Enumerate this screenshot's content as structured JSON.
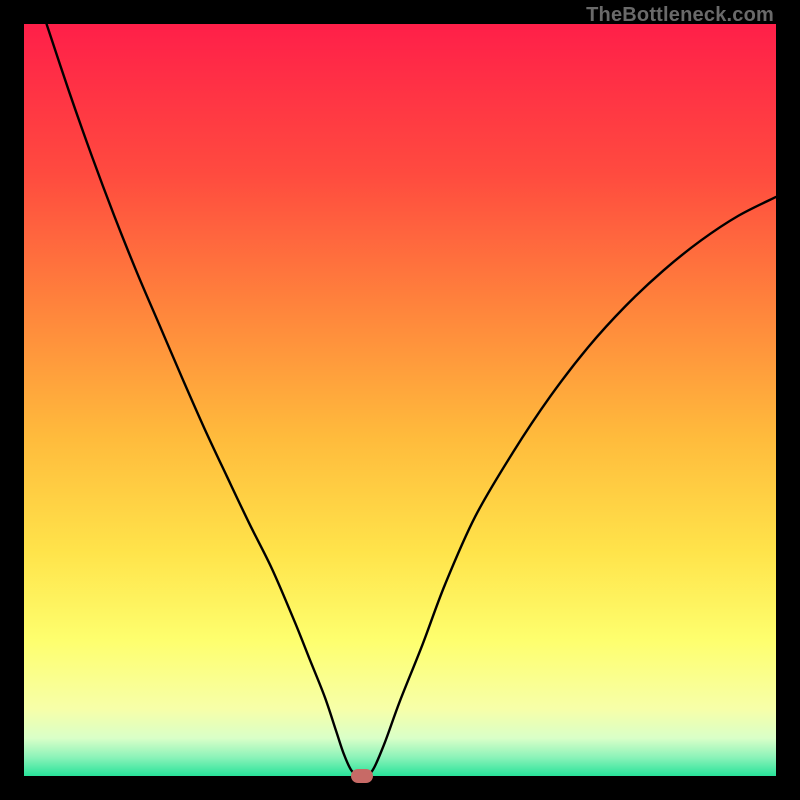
{
  "watermark": "TheBottleneck.com",
  "colors": {
    "page_bg": "#000000",
    "gradient_stops": [
      "#ff1f49",
      "#ff4b3f",
      "#ff853c",
      "#ffbb3c",
      "#ffe34a",
      "#feff6e",
      "#f7ffa8",
      "#d9ffc8",
      "#8cf3b9",
      "#28e39a"
    ],
    "line": "#000000",
    "marker": "#c76a66",
    "watermark": "#6a6a6a"
  },
  "chart_data": {
    "type": "line",
    "title": "",
    "xlabel": "",
    "ylabel": "",
    "xlim": [
      0,
      1
    ],
    "ylim": [
      0,
      1
    ],
    "grid": false,
    "legend": false,
    "x": [
      0.03,
      0.06,
      0.09,
      0.12,
      0.15,
      0.18,
      0.21,
      0.24,
      0.27,
      0.3,
      0.33,
      0.36,
      0.38,
      0.4,
      0.415,
      0.425,
      0.435,
      0.445,
      0.455,
      0.465,
      0.48,
      0.5,
      0.53,
      0.56,
      0.6,
      0.65,
      0.7,
      0.75,
      0.8,
      0.85,
      0.9,
      0.95,
      1.0
    ],
    "y": [
      1.0,
      0.91,
      0.825,
      0.745,
      0.67,
      0.6,
      0.53,
      0.462,
      0.398,
      0.335,
      0.275,
      0.205,
      0.155,
      0.105,
      0.06,
      0.03,
      0.008,
      0.0,
      0.0,
      0.01,
      0.045,
      0.1,
      0.175,
      0.255,
      0.345,
      0.43,
      0.505,
      0.57,
      0.625,
      0.672,
      0.712,
      0.745,
      0.77
    ],
    "marker": {
      "x": 0.45,
      "y": 0.0
    }
  }
}
